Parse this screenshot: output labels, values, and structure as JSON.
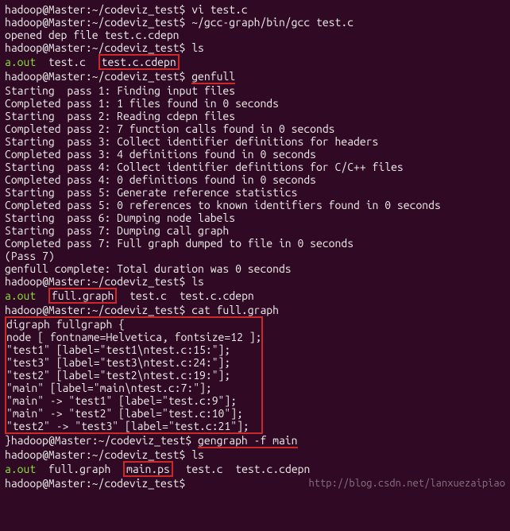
{
  "prompt": "hadoop@Master:~/codeviz_test$",
  "cmds": {
    "vi": "vi test.c",
    "gcc": "~/gcc-graph/bin/gcc test.c",
    "opened": "opened dep file test.c.cdepn",
    "ls": "ls",
    "genfull": "genfull",
    "cat": "cat full.graph",
    "gengraph": "gengraph -f main"
  },
  "ls1": {
    "aout": "a.out",
    "testc": "test.c",
    "cdepn": "test.c.cdepn"
  },
  "genfull_lines": [
    "Starting  pass 1: Finding input files",
    "Completed pass 1: 1 files found in 0 seconds",
    "Starting  pass 2: Reading cdepn files",
    "Completed pass 2: 7 function calls found in 0 seconds",
    "Starting  pass 3: Collect identifier definitions for headers",
    "Completed pass 3: 4 definitions found in 0 seconds",
    "Starting  pass 4: Collect identifier definitions for C/C++ files",
    "Completed pass 4: 0 definitions found in 0 seconds",
    "Starting  pass 5: Generate reference statistics",
    "Completed pass 5: 0 references to known identifiers found in 0 seconds",
    "Starting  pass 6: Dumping node labels",
    "Starting  pass 7: Dumping call graph",
    "Completed pass 7: Full graph dumped to file in 0 seconds",
    "(Pass 7)",
    "genfull complete: Total duration was 0 seconds"
  ],
  "ls2": {
    "aout": "a.out",
    "fullgraph": "full.graph",
    "rest": "  test.c  test.c.cdepn"
  },
  "graph_lines": [
    "digraph fullgraph {",
    "node [ fontname=Helvetica, fontsize=12 ];",
    "\"test1\" [label=\"test1\\ntest.c:15:\"];",
    "\"test3\" [label=\"test3\\ntest.c:24:\"];",
    "\"test2\" [label=\"test2\\ntest.c:19:\"];",
    "\"main\" [label=\"main\\ntest.c:7:\"];",
    "\"main\" -> \"test1\" [label=\"test.c:9\"];",
    "\"main\" -> \"test2\" [label=\"test.c:10\"];",
    "\"test2\" -> \"test3\" [label=\"test.c:21\"];"
  ],
  "graph_close": "}",
  "ls3": {
    "aout": "a.out",
    "fullgraph": "full.graph",
    "mainps": "main.ps",
    "rest": "  test.c  test.c.cdepn"
  },
  "watermark": "http://blog.csdn.net/lanxuezaipiao"
}
